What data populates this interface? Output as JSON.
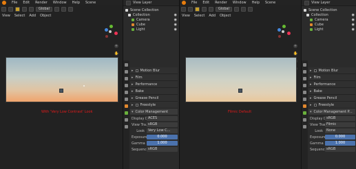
{
  "left": {
    "menu": [
      "File",
      "Edit",
      "Render",
      "Window",
      "Help",
      "Scene"
    ],
    "toolbar": {
      "view_mode": "Global"
    },
    "header_menu": [
      "View",
      "Select",
      "Add",
      "Object"
    ],
    "caption": "With 'Very Low Contrast' Look",
    "panel": {
      "title": "View Layer",
      "outliner": {
        "root": "Scene Collection",
        "collection": "Collection",
        "items": [
          "Camera",
          "Cube",
          "Light"
        ]
      },
      "sections": [
        "Motion Blur",
        "Film",
        "Performance",
        "Bake",
        "Grease Pencil",
        "Freestyle",
        "Color Management"
      ],
      "fields": [
        {
          "label": "Display D...",
          "value": "ACES"
        },
        {
          "label": "View Tra...",
          "value": "sRGB"
        },
        {
          "label": "Look",
          "value": "Very Low C..."
        },
        {
          "label": "Exposure",
          "value": "0.000"
        },
        {
          "label": "Gamma",
          "value": "1.000"
        },
        {
          "label": "Sequencer",
          "value": "sRGB"
        }
      ]
    }
  },
  "right": {
    "menu": [
      "File",
      "Edit",
      "Render",
      "Window",
      "Help",
      "Scene"
    ],
    "toolbar": {
      "view_mode": "Global"
    },
    "header_menu": [
      "View",
      "Select",
      "Add",
      "Object"
    ],
    "caption": "Filmic Default",
    "panel": {
      "title": "View Layer",
      "outliner": {
        "root": "Scene Collection",
        "collection": "Collection",
        "items": [
          "Camera",
          "Cube",
          "Light"
        ]
      },
      "sections": [
        "Motion Blur",
        "Film",
        "Performance",
        "Bake",
        "Grease Pencil",
        "Freestyle",
        "Color Management P..."
      ],
      "fields": [
        {
          "label": "Display De...",
          "value": "sRGB"
        },
        {
          "label": "View Transf...",
          "value": "Filmic"
        },
        {
          "label": "Look",
          "value": "None"
        },
        {
          "label": "Exposure",
          "value": "0.000"
        },
        {
          "label": "Gamma",
          "value": "1.000"
        },
        {
          "label": "Sequencer",
          "value": "sRGB"
        }
      ]
    }
  },
  "colors": {
    "accent": "#4b72ad",
    "caption": "#e41b1b",
    "blender_logo": "#e87d0d"
  }
}
